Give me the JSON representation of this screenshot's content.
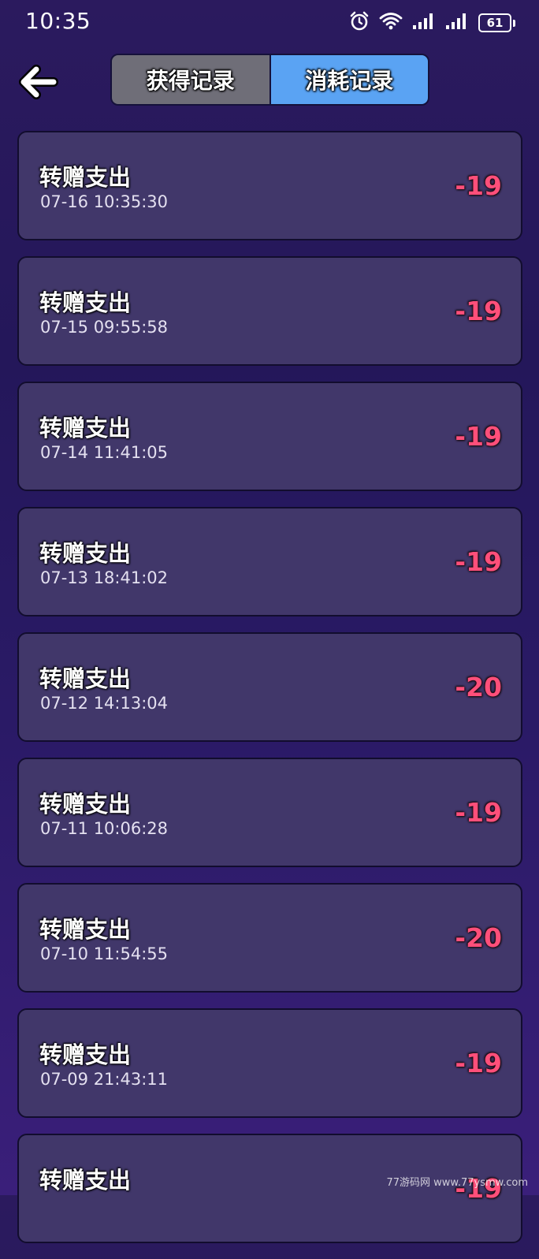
{
  "status_bar": {
    "time": "10:35",
    "battery": "61",
    "icons": [
      "alarm-icon",
      "wifi-icon",
      "signal-icon",
      "signal-icon",
      "battery-icon"
    ]
  },
  "header": {
    "back_icon": "arrow-left-icon",
    "tabs": [
      {
        "label": "获得记录",
        "active": false
      },
      {
        "label": "消耗记录",
        "active": true
      }
    ]
  },
  "records": [
    {
      "title": "转赠支出",
      "time": "07-16 10:35:30",
      "amount": "-19"
    },
    {
      "title": "转赠支出",
      "time": "07-15 09:55:58",
      "amount": "-19"
    },
    {
      "title": "转赠支出",
      "time": "07-14 11:41:05",
      "amount": "-19"
    },
    {
      "title": "转赠支出",
      "time": "07-13 18:41:02",
      "amount": "-19"
    },
    {
      "title": "转赠支出",
      "time": "07-12 14:13:04",
      "amount": "-20"
    },
    {
      "title": "转赠支出",
      "time": "07-11 10:06:28",
      "amount": "-19"
    },
    {
      "title": "转赠支出",
      "time": "07-10 11:54:55",
      "amount": "-20"
    },
    {
      "title": "转赠支出",
      "time": "07-09 21:43:11",
      "amount": "-19"
    },
    {
      "title": "转赠支出",
      "time": "",
      "amount": "-19"
    }
  ],
  "watermark": "77游码网 www.77ysmw.com",
  "colors": {
    "background": "#2b1a5e",
    "card": "#41376a",
    "tab_active": "#5aa3f3",
    "tab_inactive": "#6f6e78",
    "amount": "#ff4f7a"
  }
}
